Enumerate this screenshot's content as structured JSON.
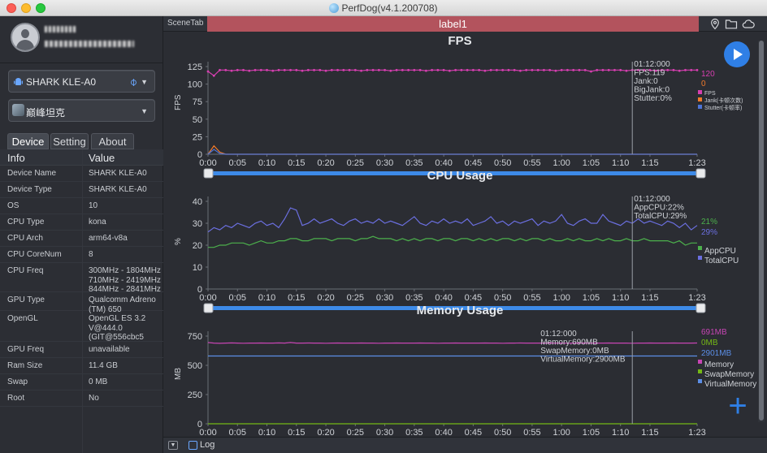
{
  "window": {
    "title": "PerfDog(v4.1.200708)"
  },
  "sidebar": {
    "device_select": {
      "value": "SHARK KLE-A0"
    },
    "app_select": {
      "value": "巅峰坦克"
    },
    "tabs": [
      {
        "label": "Device"
      },
      {
        "label": "Setting"
      },
      {
        "label": "About"
      }
    ],
    "table": {
      "headers": {
        "key": "Info",
        "value": "Value"
      },
      "rows": [
        {
          "key": "Device Name",
          "value": "SHARK KLE-A0"
        },
        {
          "key": "Device Type",
          "value": "SHARK KLE-A0"
        },
        {
          "key": "OS",
          "value": "10"
        },
        {
          "key": "CPU Type",
          "value": "kona"
        },
        {
          "key": "CPU Arch",
          "value": "arm64-v8a"
        },
        {
          "key": "CPU CoreNum",
          "value": "8"
        },
        {
          "key": "CPU Freq",
          "value": "300MHz - 1804MHz\n710MHz - 2419MHz\n844MHz - 2841MHz"
        },
        {
          "key": "GPU Type",
          "value": "Qualcomm Adreno\n(TM) 650"
        },
        {
          "key": "OpenGL",
          "value": "OpenGL ES 3.2\nV@444.0\n(GIT@556cbc5"
        },
        {
          "key": "GPU Freq",
          "value": "unavailable"
        },
        {
          "key": "Ram Size",
          "value": "11.4 GB"
        },
        {
          "key": "Swap",
          "value": "0 MB"
        },
        {
          "key": "Root",
          "value": "No"
        }
      ]
    }
  },
  "main": {
    "scene_tab_label": "SceneTab",
    "label_bar": "label1",
    "log_label": "Log",
    "icons": [
      "location-icon",
      "folder-icon",
      "cloud-icon",
      "play-icon",
      "plus-icon"
    ]
  },
  "colors": {
    "fps": "#d63fb0",
    "jank": "#f07a2a",
    "stutter": "#4e74d6",
    "app_cpu": "#4cb04c",
    "total_cpu": "#6b6fe0",
    "memory": "#c745b4",
    "swap": "#74b816",
    "virtual": "#5b8ee6",
    "label_bar": "#b3535d",
    "accent": "#2f7fe6"
  },
  "chart_data": [
    {
      "type": "line",
      "title": "FPS",
      "ylabel": "FPS",
      "ylim": [
        0,
        125
      ],
      "yticks": [
        "0",
        "25",
        "50",
        "75",
        "100",
        "125"
      ],
      "xticks": [
        "0:00",
        "0:05",
        "0:10",
        "0:15",
        "0:20",
        "0:25",
        "0:30",
        "0:35",
        "0:40",
        "0:45",
        "0:50",
        "0:55",
        "1:00",
        "1:05",
        "1:10",
        "1:15",
        "1:23"
      ],
      "cursor": {
        "time": "01:12:000",
        "lines": [
          "01:12:000",
          "FPS:119",
          "Jank:0",
          "BigJank:0",
          "Stutter:0%"
        ]
      },
      "current_values": [
        "120",
        "0"
      ],
      "series": [
        {
          "name": "FPS",
          "color": "#d63fb0",
          "values": [
            118,
            112,
            120,
            120,
            119,
            120,
            120,
            119,
            120,
            120,
            120,
            119,
            120,
            120,
            120,
            120,
            119,
            120,
            120,
            120,
            119,
            120,
            120,
            120,
            120,
            120,
            119,
            120,
            120,
            120,
            120,
            119,
            120,
            120,
            120,
            120,
            120,
            119,
            120,
            120,
            120,
            119,
            120,
            120,
            120,
            120,
            120,
            119,
            120,
            120,
            120,
            120,
            120,
            119,
            120,
            120,
            120,
            120,
            120,
            119,
            120,
            120,
            120,
            120,
            120,
            118,
            120,
            120,
            120,
            120,
            120,
            119,
            120,
            120,
            120,
            120,
            119,
            120,
            120,
            120,
            119,
            120,
            120,
            120
          ]
        },
        {
          "name": "Jank(卡顿次数)",
          "color": "#f07a2a",
          "values": [
            0,
            12,
            3,
            0,
            0,
            0,
            0,
            0,
            0,
            0,
            0,
            0,
            0,
            0,
            0,
            0,
            0,
            0,
            0,
            0,
            0,
            0,
            0,
            0,
            0,
            0,
            0,
            0,
            0,
            0,
            0,
            0,
            0,
            0,
            0,
            0,
            0,
            0,
            0,
            0,
            0,
            0,
            0,
            0,
            0,
            0,
            0,
            0,
            0,
            0,
            0,
            0,
            0,
            0,
            0,
            0,
            0,
            0,
            0,
            0,
            0,
            0,
            0,
            0,
            0,
            0,
            0,
            0,
            0,
            0,
            0,
            0,
            0,
            0,
            0,
            0,
            0,
            0,
            0,
            0,
            0,
            0,
            0,
            0
          ]
        },
        {
          "name": "Stutter(卡顿率)",
          "color": "#4e74d6",
          "values": [
            0,
            7,
            1,
            0,
            0,
            0,
            0,
            0,
            0,
            0,
            0,
            0,
            0,
            0,
            0,
            0,
            0,
            0,
            0,
            0,
            0,
            0,
            0,
            0,
            0,
            0,
            0,
            0,
            0,
            0,
            0,
            0,
            0,
            0,
            0,
            0,
            0,
            0,
            0,
            0,
            0,
            0,
            0,
            0,
            0,
            0,
            0,
            0,
            0,
            0,
            0,
            0,
            0,
            0,
            0,
            0,
            0,
            0,
            0,
            0,
            0,
            0,
            0,
            0,
            0,
            0,
            0,
            0,
            0,
            0,
            0,
            0,
            0,
            0,
            0,
            0,
            0,
            0,
            0,
            0,
            0,
            0,
            0,
            0
          ]
        }
      ]
    },
    {
      "type": "line",
      "title": "CPU Usage",
      "ylabel": "%",
      "ylim": [
        0,
        40
      ],
      "yticks": [
        "0",
        "10",
        "20",
        "30",
        "40"
      ],
      "xticks": [
        "0:00",
        "0:05",
        "0:10",
        "0:15",
        "0:20",
        "0:25",
        "0:30",
        "0:35",
        "0:40",
        "0:45",
        "0:50",
        "0:55",
        "1:00",
        "1:05",
        "1:10",
        "1:15",
        "1:23"
      ],
      "cursor": {
        "time": "01:12:000",
        "lines": [
          "01:12:000",
          "AppCPU:22%",
          "TotalCPU:29%"
        ]
      },
      "current_values": [
        "21%",
        "29%"
      ],
      "series": [
        {
          "name": "AppCPU",
          "color": "#4cb04c",
          "values": [
            19,
            19,
            20,
            20,
            21,
            21,
            21,
            20,
            21,
            22,
            21,
            21,
            22,
            22,
            23,
            23,
            22,
            22,
            23,
            23,
            23,
            22,
            23,
            23,
            23,
            22,
            23,
            23,
            24,
            23,
            23,
            23,
            22,
            23,
            22,
            23,
            22,
            23,
            23,
            22,
            23,
            23,
            22,
            23,
            23,
            22,
            23,
            22,
            23,
            22,
            23,
            23,
            22,
            23,
            22,
            23,
            23,
            22,
            23,
            22,
            22,
            23,
            22,
            23,
            22,
            22,
            23,
            22,
            23,
            22,
            22,
            23,
            22,
            22,
            23,
            22,
            22,
            22,
            22,
            21,
            22,
            20,
            21,
            21
          ]
        },
        {
          "name": "TotalCPU",
          "color": "#6b6fe0",
          "values": [
            26,
            28,
            27,
            29,
            28,
            30,
            29,
            28,
            30,
            31,
            29,
            30,
            28,
            32,
            37,
            36,
            29,
            30,
            32,
            30,
            31,
            32,
            30,
            29,
            31,
            32,
            30,
            31,
            30,
            32,
            30,
            31,
            30,
            29,
            31,
            33,
            30,
            29,
            31,
            30,
            32,
            30,
            31,
            30,
            32,
            29,
            30,
            31,
            33,
            30,
            31,
            29,
            31,
            30,
            31,
            32,
            29,
            31,
            30,
            31,
            34,
            30,
            29,
            31,
            32,
            30,
            30,
            34,
            31,
            30,
            29,
            31,
            30,
            32,
            30,
            31,
            30,
            29,
            31,
            30,
            28,
            30,
            27,
            29
          ]
        }
      ]
    },
    {
      "type": "line",
      "title": "Memory Usage",
      "ylabel": "MB",
      "ylim": [
        0,
        750
      ],
      "yticks": [
        "0",
        "250",
        "500",
        "750"
      ],
      "xticks": [
        "0:00",
        "0:05",
        "0:10",
        "0:15",
        "0:20",
        "0:25",
        "0:30",
        "0:35",
        "0:40",
        "0:45",
        "0:50",
        "0:55",
        "1:00",
        "1:05",
        "1:10",
        "1:15",
        "1:23"
      ],
      "cursor": {
        "time": "01:12:000",
        "lines": [
          "01:12:000",
          "Memory:690MB",
          "SwapMemory:0MB",
          "VirtualMemory:2900MB"
        ]
      },
      "current_values": [
        "691MB",
        "0MB",
        "2901MB"
      ],
      "series": [
        {
          "name": "Memory",
          "color": "#c745b4",
          "values": [
            695,
            690,
            688,
            690,
            692,
            690,
            689,
            690,
            690,
            691,
            690,
            690,
            692,
            690,
            695,
            690,
            690,
            691,
            690,
            690,
            689,
            690,
            691,
            690,
            690,
            690,
            691,
            690,
            690,
            689,
            690,
            690,
            691,
            690,
            690,
            690,
            691,
            690,
            690,
            689,
            690,
            690,
            691,
            690,
            690,
            690,
            690,
            691,
            690,
            690,
            689,
            690,
            690,
            691,
            690,
            690,
            690,
            690,
            691,
            690,
            690,
            689,
            690,
            690,
            691,
            690,
            690,
            690,
            691,
            690,
            690,
            690,
            689,
            690,
            690,
            691,
            690,
            690,
            690,
            691,
            690,
            690,
            690,
            691
          ]
        },
        {
          "name": "SwapMemory",
          "color": "#74b816",
          "values": [
            0,
            0,
            0,
            0,
            0,
            0,
            0,
            0,
            0,
            0,
            0,
            0,
            0,
            0,
            0,
            0,
            0,
            0,
            0,
            0,
            0,
            0,
            0,
            0,
            0,
            0,
            0,
            0,
            0,
            0,
            0,
            0,
            0,
            0,
            0,
            0,
            0,
            0,
            0,
            0,
            0,
            0,
            0,
            0,
            0,
            0,
            0,
            0,
            0,
            0,
            0,
            0,
            0,
            0,
            0,
            0,
            0,
            0,
            0,
            0,
            0,
            0,
            0,
            0,
            0,
            0,
            0,
            0,
            0,
            0,
            0,
            0,
            0,
            0,
            0,
            0,
            0,
            0,
            0,
            0,
            0,
            0,
            0,
            0
          ]
        },
        {
          "name": "VirtualMemory",
          "color": "#5b8ee6",
          "values": [
            580,
            580,
            580,
            580,
            580,
            580,
            580,
            580,
            580,
            580,
            580,
            580,
            580,
            580,
            580,
            580,
            580,
            580,
            580,
            580,
            580,
            580,
            580,
            580,
            580,
            580,
            580,
            580,
            580,
            580,
            580,
            580,
            580,
            580,
            580,
            580,
            580,
            580,
            580,
            580,
            580,
            580,
            580,
            580,
            580,
            580,
            580,
            580,
            580,
            580,
            580,
            580,
            580,
            580,
            580,
            580,
            580,
            580,
            580,
            580,
            580,
            580,
            580,
            580,
            580,
            580,
            580,
            580,
            580,
            580,
            580,
            580,
            580,
            580,
            580,
            580,
            580,
            580,
            580,
            580,
            580,
            580,
            580,
            580
          ]
        }
      ]
    }
  ]
}
